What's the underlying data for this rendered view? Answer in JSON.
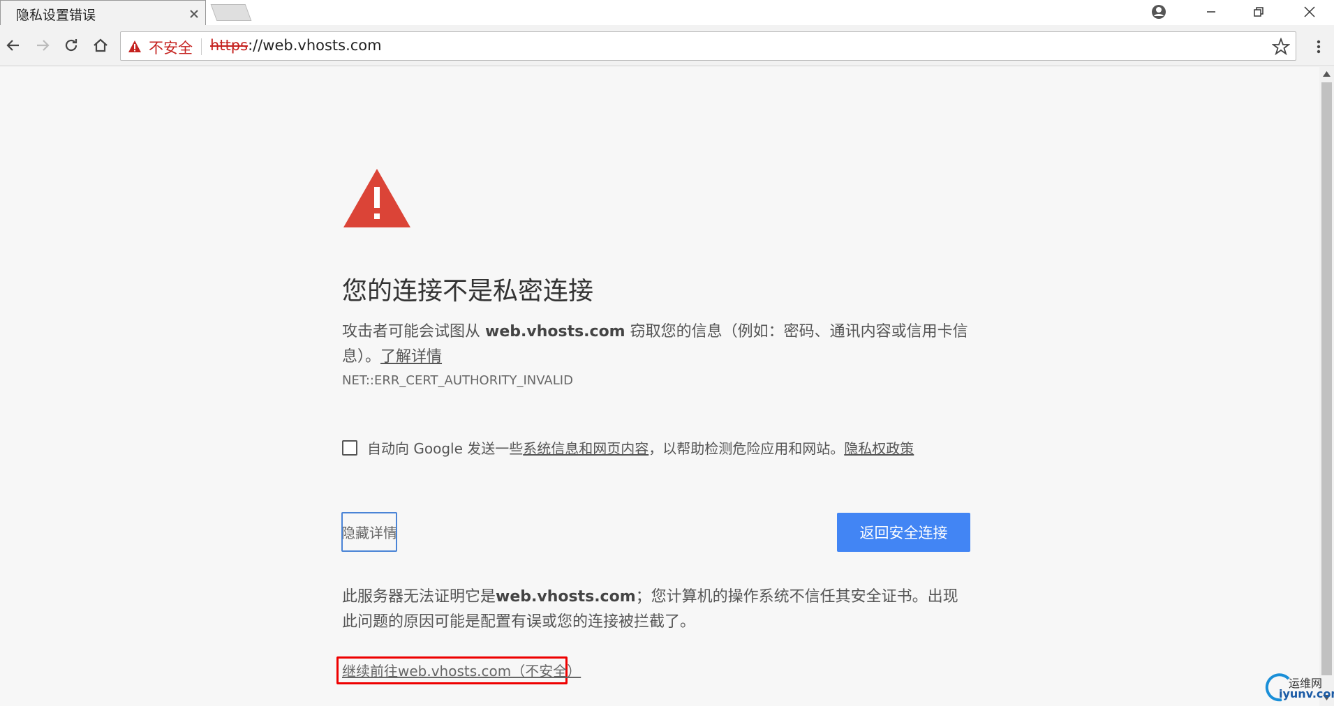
{
  "tab": {
    "title": "隐私设置错误"
  },
  "omnibox": {
    "security_label": "不安全",
    "url_scheme": "https",
    "url_rest": "://web.vhosts.com"
  },
  "page": {
    "heading": "您的连接不是私密连接",
    "para_prefix": "攻击者可能会试图从 ",
    "para_domain": "web.vhosts.com",
    "para_suffix": " 窃取您的信息（例如：密码、通讯内容或信用卡信息）。",
    "learn_more": "了解详情",
    "error_code": "NET::ERR_CERT_AUTHORITY_INVALID",
    "checkbox_prefix": "自动向 Google 发送一些",
    "checkbox_link": "系统信息和网页内容",
    "checkbox_mid": "，以帮助检测危险应用和网站。",
    "privacy_link": "隐私权政策",
    "hide_details": "隐藏详情",
    "back_to_safety": "返回安全连接",
    "details_prefix": "此服务器无法证明它是",
    "details_domain": "web.vhosts.com",
    "details_suffix": "；您计算机的操作系统不信任其安全证书。出现此问题的原因可能是配置有误或您的连接被拦截了。",
    "proceed_link": "继续前往web.vhosts.com（不安全）"
  },
  "watermark": {
    "line1": "运维网",
    "line2": "iyunv.com"
  },
  "colors": {
    "accent": "#4285f4",
    "danger": "#db4437",
    "highlight": "#ee0000"
  }
}
